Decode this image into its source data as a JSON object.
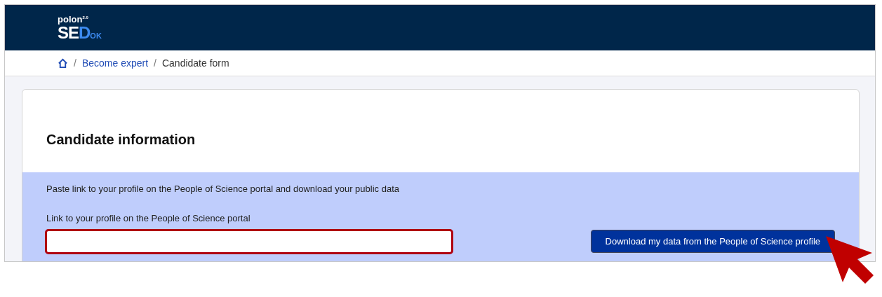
{
  "logo": {
    "top": "polon",
    "version": "2.0",
    "main_light": "SE",
    "main_accent": "D",
    "suffix": "OK"
  },
  "breadcrumb": {
    "separator": "/",
    "items": [
      {
        "kind": "home"
      },
      {
        "kind": "link",
        "label": "Become expert"
      },
      {
        "kind": "current",
        "label": "Candidate form"
      }
    ]
  },
  "card": {
    "title": "Candidate information",
    "import": {
      "instruction": "Paste link to your profile on the People of Science portal and download your public data",
      "field_label": "Link to your profile on the People of Science portal",
      "field_invalid": true,
      "button": "Download my data from the People of Science profile"
    }
  },
  "pointer": {
    "kind": "arrow"
  }
}
